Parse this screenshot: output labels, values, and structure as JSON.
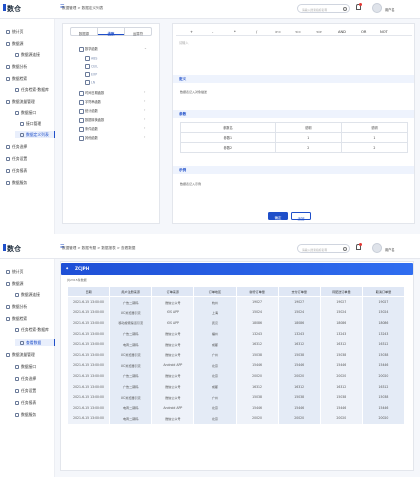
{
  "header": {
    "logo": "数仓",
    "user_name": "用户名",
    "search_placeholder": "请输入搜索指标名称",
    "breadcrumb_1": "数据管理 > 数据定义列表",
    "breadcrumb_2": "数据管理 > 数据专题 > 数据报表 > 查看数据"
  },
  "sidebar": {
    "items": [
      "统计页",
      "数据源",
      "数据源连接",
      "数据分析",
      "数据检索",
      "任务检索·数据库",
      "数据流量管理",
      "数据接口",
      "接口管理",
      "数据定义列表",
      "任务选择",
      "任务设置",
      "任务报表",
      "数据服务"
    ],
    "items2": [
      "统计页",
      "数据源",
      "数据源连接",
      "数据分析",
      "数据检索",
      "任务检索·数据库",
      "查看数据",
      "数据流量管理",
      "数据接口",
      "任务选择",
      "任务设置",
      "任务报表",
      "数据服务"
    ]
  },
  "editor": {
    "tabs": [
      "数据源",
      "函数",
      "运算符"
    ],
    "tree": [
      "数学函数",
      "ABS",
      "CEIL",
      "EXP",
      "LN",
      "时间日期函数",
      "字符串函数",
      "统计函数",
      "数据转换函数",
      "条件函数",
      "其他函数"
    ],
    "operators": [
      "+",
      "-",
      "*",
      "/",
      ">=",
      "<=",
      "<>",
      "AND",
      "OR",
      "NOT"
    ],
    "input_placeholder": "请输入",
    "definition_title": "定义",
    "definition_text": "数据表记入对象描述",
    "params_title": "参数",
    "params_headers": [
      "参数名",
      "说明",
      "说明"
    ],
    "params_rows": [
      [
        "参数1",
        "1",
        "1"
      ],
      [
        "参数2",
        "2",
        "2"
      ]
    ],
    "example_title": "示例",
    "example_text": "数据表记入示例",
    "confirm_label": "确定",
    "cancel_label": "返回"
  },
  "report": {
    "banner_title": "ZCJPH",
    "subtitle": "共2315条数据",
    "columns": [
      "日期",
      "用户注册来源",
      "订单来源",
      "订单地区",
      "新增订单量",
      "支付订单量",
      "待配送订单量",
      "取消订单量"
    ],
    "rows": [
      [
        "2021-6-15 13:00:00",
        "广告二期码",
        "微信公众号",
        "杭州",
        "19027",
        "19027",
        "19027",
        "19027"
      ],
      [
        "2021-6-15 13:00:00",
        "UC浏览器引流",
        "iOS APP",
        "上海",
        "15024",
        "15024",
        "15024",
        "15024"
      ],
      [
        "2021-6-15 13:00:00",
        "移动搜索渠道引流",
        "iOS APP",
        "武汉",
        "18086",
        "18086",
        "18086",
        "18086"
      ],
      [
        "2021-6-15 13:00:00",
        "广告二期码",
        "微信公众号",
        "福州",
        "13243",
        "13243",
        "13243",
        "13243"
      ],
      [
        "2021-6-15 13:00:00",
        "电商二期码",
        "微信公众号",
        "成都",
        "16312",
        "16312",
        "16312",
        "16312"
      ],
      [
        "2021-6-15 13:00:00",
        "UC浏览器引流",
        "微信公众号",
        "广州",
        "15038",
        "15038",
        "15038",
        "15038"
      ],
      [
        "2021-6-15 13:00:00",
        "UC浏览器引流",
        "Android APP",
        "北京",
        "15446",
        "15446",
        "15446",
        "15446"
      ],
      [
        "2021-6-15 13:00:00",
        "广告二期码",
        "微信公众号",
        "北京",
        "20020",
        "20020",
        "20020",
        "20020"
      ],
      [
        "2021-6-15 13:00:00",
        "广告二期码",
        "微信公众号",
        "成都",
        "16312",
        "16312",
        "16312",
        "16312"
      ],
      [
        "2021-6-15 13:00:00",
        "UC浏览器引流",
        "微信公众号",
        "广州",
        "15038",
        "15038",
        "15038",
        "15038"
      ],
      [
        "2021-6-15 13:00:00",
        "电商二期码",
        "Android APP",
        "北京",
        "15446",
        "15446",
        "15446",
        "15446"
      ],
      [
        "2021-6-15 13:00:00",
        "电商二期码",
        "微信公众号",
        "北京",
        "20020",
        "20020",
        "20020",
        "20020"
      ]
    ]
  }
}
